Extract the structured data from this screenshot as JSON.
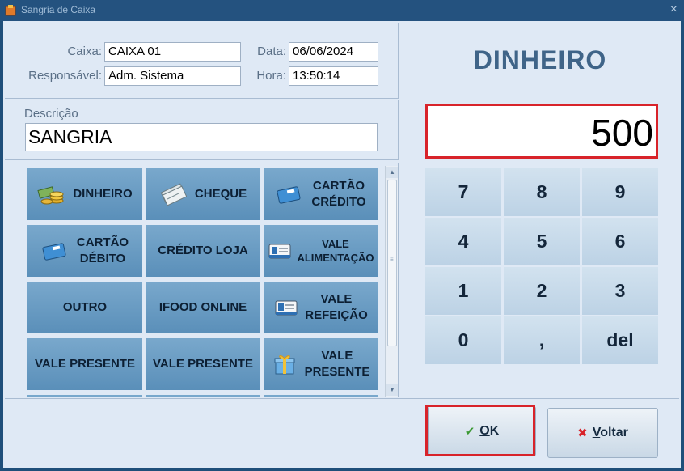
{
  "window": {
    "title": "Sangria de Caixa",
    "close": "×"
  },
  "info": {
    "caixa_label": "Caixa:",
    "caixa_value": "CAIXA 01",
    "data_label": "Data:",
    "data_value": "06/06/2024",
    "responsavel_label": "Responsável:",
    "responsavel_value": "Adm. Sistema",
    "hora_label": "Hora:",
    "hora_value": "13:50:14"
  },
  "descricao": {
    "label": "Descrição",
    "value": "SANGRIA"
  },
  "payment_buttons": [
    {
      "label": "DINHEIRO",
      "icon": "coins-icon"
    },
    {
      "label": "CHEQUE",
      "icon": "cheque-icon"
    },
    {
      "label": "CARTÃO CRÉDITO",
      "line1": "CARTÃO",
      "line2": "CRÉDITO",
      "icon": "credit-card-icon"
    },
    {
      "label": "CARTÃO DÉBITO",
      "line1": "CARTÃO",
      "line2": "DÉBITO",
      "icon": "debit-card-icon"
    },
    {
      "label": "CRÉDITO LOJA",
      "icon": ""
    },
    {
      "label": "VALE ALIMENTAÇÃO",
      "line1": "VALE",
      "line2": "ALIMENTAÇÃO",
      "icon": "meal-voucher-icon"
    },
    {
      "label": "OUTRO",
      "icon": ""
    },
    {
      "label": "IFOOD ONLINE",
      "icon": ""
    },
    {
      "label": "VALE REFEIÇÃO",
      "line1": "VALE",
      "line2": "REFEIÇÃO",
      "icon": "meal-voucher-icon"
    },
    {
      "label": "VALE PRESENTE",
      "icon": ""
    },
    {
      "label": "VALE PRESENTE",
      "icon": ""
    },
    {
      "label": "VALE PRESENTE",
      "line1": "VALE",
      "line2": "PRESENTE",
      "icon": "gift-icon"
    }
  ],
  "selected_method": "DINHEIRO",
  "amount": "500",
  "keypad": [
    "7",
    "8",
    "9",
    "4",
    "5",
    "6",
    "1",
    "2",
    "3",
    "0",
    ",",
    "del"
  ],
  "footer": {
    "ok_label": "OK",
    "ok_mnemonic": "O",
    "ok_rest": "K",
    "voltar_label": "Voltar",
    "voltar_mnemonic": "V",
    "voltar_rest": "oltar"
  },
  "colors": {
    "accent_red": "#d8232a",
    "title_blue": "#3f6488",
    "button_blue": "#5a8fb9"
  }
}
